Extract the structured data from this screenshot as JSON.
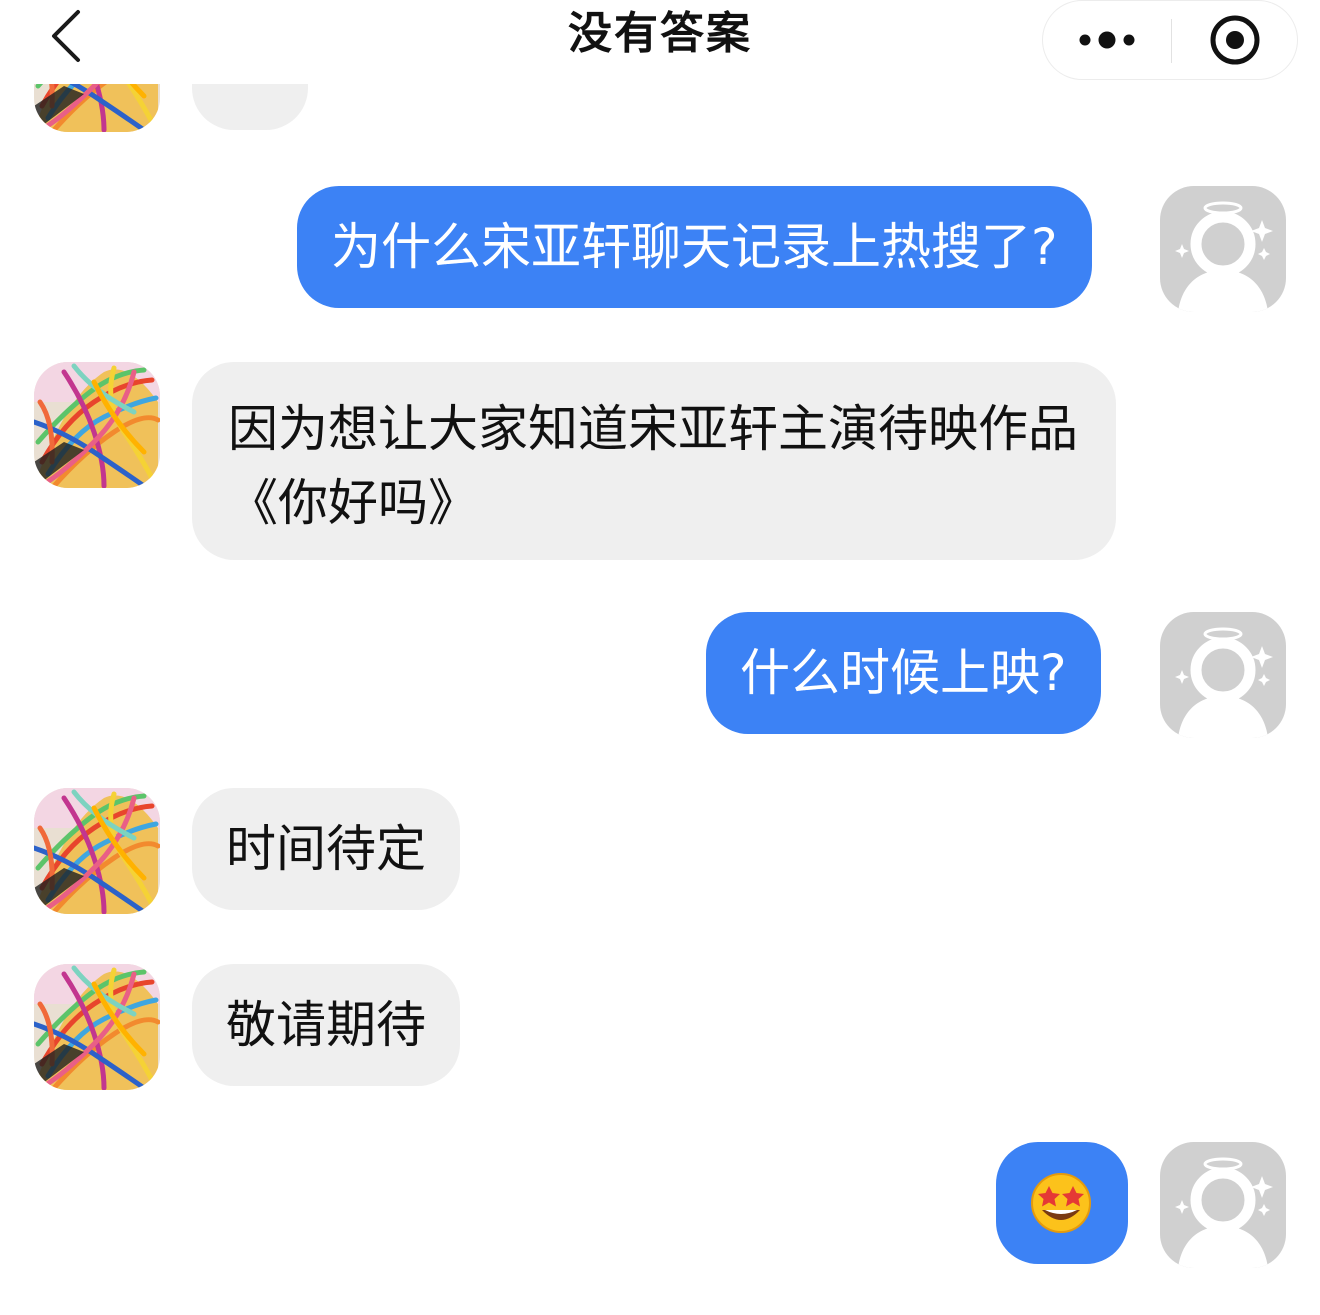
{
  "header": {
    "title": "没有答案",
    "back_icon": "chevron-left-icon",
    "more_icon": "more-dots-icon",
    "close_icon": "target-close-icon"
  },
  "colors": {
    "outgoing_bubble": "#3c82f5",
    "incoming_bubble": "#efefef",
    "default_avatar": "#d0d0d0"
  },
  "messages": [
    {
      "sender": "other",
      "text": ""
    },
    {
      "sender": "me",
      "text": "为什么宋亚轩聊天记录上热搜了?"
    },
    {
      "sender": "other",
      "text": "因为想让大家知道宋亚轩主演待映作品《你好吗》"
    },
    {
      "sender": "me",
      "text": "什么时候上映?"
    },
    {
      "sender": "other",
      "text": "时间待定"
    },
    {
      "sender": "other",
      "text": "敬请期待"
    },
    {
      "sender": "me",
      "emoji": "star-struck-emoji"
    }
  ]
}
